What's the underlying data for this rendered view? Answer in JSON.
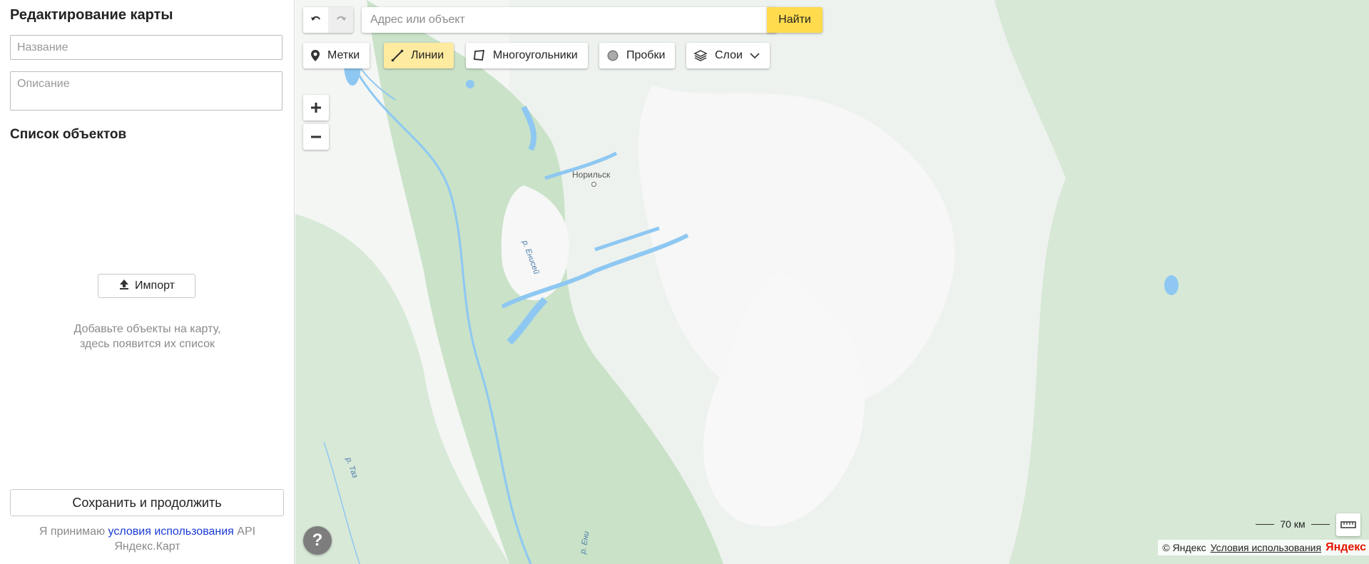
{
  "sidebar": {
    "title": "Редактирование карты",
    "name_placeholder": "Название",
    "description_placeholder": "Описание",
    "objects_title": "Список объектов",
    "import_label": "Импорт",
    "hint_line1": "Добавьте объекты на карту,",
    "hint_line2": "здесь появится их список",
    "save_label": "Сохранить и продолжить",
    "terms_prefix": "Я принимаю ",
    "terms_link": "условия использования",
    "terms_suffix": " API",
    "terms_line2": "Яндекс.Карт"
  },
  "map": {
    "search_placeholder": "Адрес или объект",
    "search_button": "Найти",
    "tools": [
      {
        "label": "Метки",
        "icon": "pin-icon",
        "active": false
      },
      {
        "label": "Линии",
        "icon": "line-icon",
        "active": true
      },
      {
        "label": "Многоугольники",
        "icon": "polygon-icon",
        "active": false
      },
      {
        "label": "Пробки",
        "icon": "traffic-icon",
        "active": false
      },
      {
        "label": "Слои",
        "icon": "layers-icon",
        "active": false
      }
    ],
    "city_label": "Норильск",
    "river_labels": [
      "р. Енисей",
      "р. Таз",
      "р. Ени"
    ],
    "help_label": "?",
    "scale_label": "70 км",
    "copyright": "© Яндекс",
    "copyright_terms": "Условия использования",
    "brand": "Яндекс",
    "colors": {
      "search_button": "#ffdb4d",
      "active_tool": "#ffeba0",
      "link": "#1a3ad6",
      "water": "#8ec8f2",
      "forest": "#bfdcc0",
      "land": "#eef2ee"
    }
  }
}
